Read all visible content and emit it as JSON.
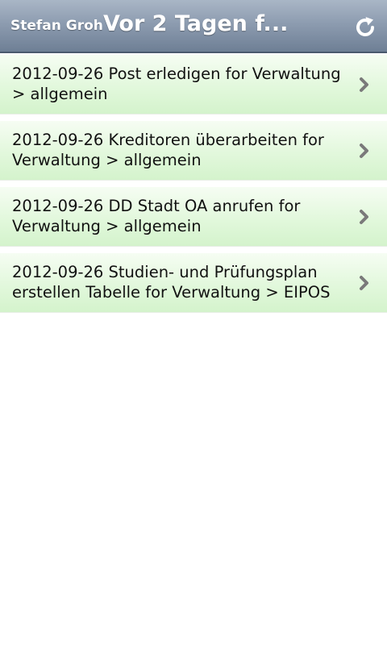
{
  "header": {
    "user_name": "Stefan Groh",
    "title": "Vor 2 Tagen f...",
    "refresh_icon": "refresh-icon"
  },
  "tasks": [
    {
      "text": "2012-09-26 Post erledigen for Verwaltung > allgemein"
    },
    {
      "text": "2012-09-26 Kreditoren überarbeiten for Verwaltung > allgemein"
    },
    {
      "text": "2012-09-26 DD Stadt OA anrufen for Verwaltung > allgemein"
    },
    {
      "text": "2012-09-26 Studien- und Prüfungsplan erstellen Tabelle for Verwaltung > EIPOS"
    }
  ],
  "colors": {
    "titlebar": "#8d9cb0",
    "item_background": "#e2f8dc",
    "chevron": "#7a7a7a"
  }
}
